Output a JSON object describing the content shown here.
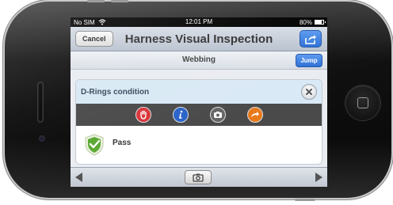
{
  "statusbar": {
    "carrier": "No SIM",
    "time": "12:01 PM",
    "battery": "80%",
    "battery_level": 0.8
  },
  "navbar": {
    "cancel_label": "Cancel",
    "title": "Harness Visual Inspection",
    "share_icon": "share-icon"
  },
  "section": {
    "title": "Webbing",
    "jump_label": "Jump"
  },
  "item": {
    "title": "D-Rings condition",
    "close_icon": "close-icon",
    "tools": [
      {
        "icon": "stop-hand-icon",
        "color": "#d8343a"
      },
      {
        "icon": "info-icon",
        "color": "#2a63c9"
      },
      {
        "icon": "camera-icon",
        "color": "#666666"
      },
      {
        "icon": "redo-arrow-icon",
        "color": "#e87a1c"
      }
    ],
    "result": {
      "icon": "pass-shield-icon",
      "label": "Pass",
      "color": "#5aa832"
    }
  },
  "bottombar": {
    "prev_icon": "arrow-left-icon",
    "camera_icon": "camera-icon",
    "next_icon": "arrow-right-icon"
  }
}
